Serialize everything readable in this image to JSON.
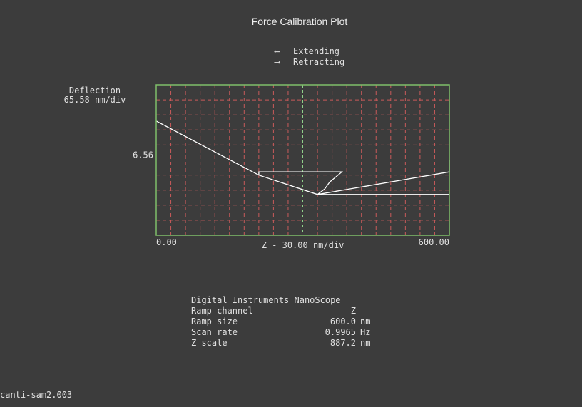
{
  "title": "Force Calibration Plot",
  "legend": [
    {
      "arrow": "⟵",
      "label": "Extending"
    },
    {
      "arrow": "⟶",
      "label": "Retracting"
    }
  ],
  "y_axis": {
    "label_line1": "Deflection",
    "label_line2": "65.58 nm/div",
    "tick_label": "6.56"
  },
  "x_axis": {
    "min_label": "0.00",
    "max_label": "600.00",
    "label": "Z - 30.00 nm/div"
  },
  "info": {
    "header": "Digital Instruments NanoScope",
    "rows": [
      {
        "label": "Ramp channel",
        "value": "Z",
        "unit": ""
      },
      {
        "label": "Ramp size",
        "value": "600.0",
        "unit": "nm"
      },
      {
        "label": "Scan rate",
        "value": "0.9965",
        "unit": "Hz"
      },
      {
        "label": "Z scale",
        "value": "887.2",
        "unit": "nm"
      }
    ]
  },
  "filename": "canti-sam2.003",
  "colors": {
    "background": "#3c3c3c",
    "plot_frame": "#7fbf6a",
    "grid": "#c85a5a",
    "center_line": "#8fd08a",
    "trace": "#ffffff"
  },
  "chart_data": {
    "type": "line",
    "title": "Force Calibration Plot",
    "xlabel": "Z - 30.00 nm/div",
    "ylabel": "Deflection 65.58 nm/div",
    "xlim": [
      0,
      600
    ],
    "ylim": [
      -327.9,
      327.9
    ],
    "grid": true,
    "legend_position": "top",
    "series": [
      {
        "name": "Extending",
        "x": [
          0,
          210,
          330,
          600
        ],
        "y": [
          170,
          -66,
          -150,
          -150
        ],
        "note_direction": "left"
      },
      {
        "name": "Retracting",
        "x": [
          210,
          210,
          380,
          380,
          355,
          345,
          330,
          600,
          600
        ],
        "y": [
          -66,
          -52,
          -52,
          -52,
          -96,
          -126,
          -150,
          -52,
          0
        ],
        "note_direction": "right"
      }
    ]
  }
}
